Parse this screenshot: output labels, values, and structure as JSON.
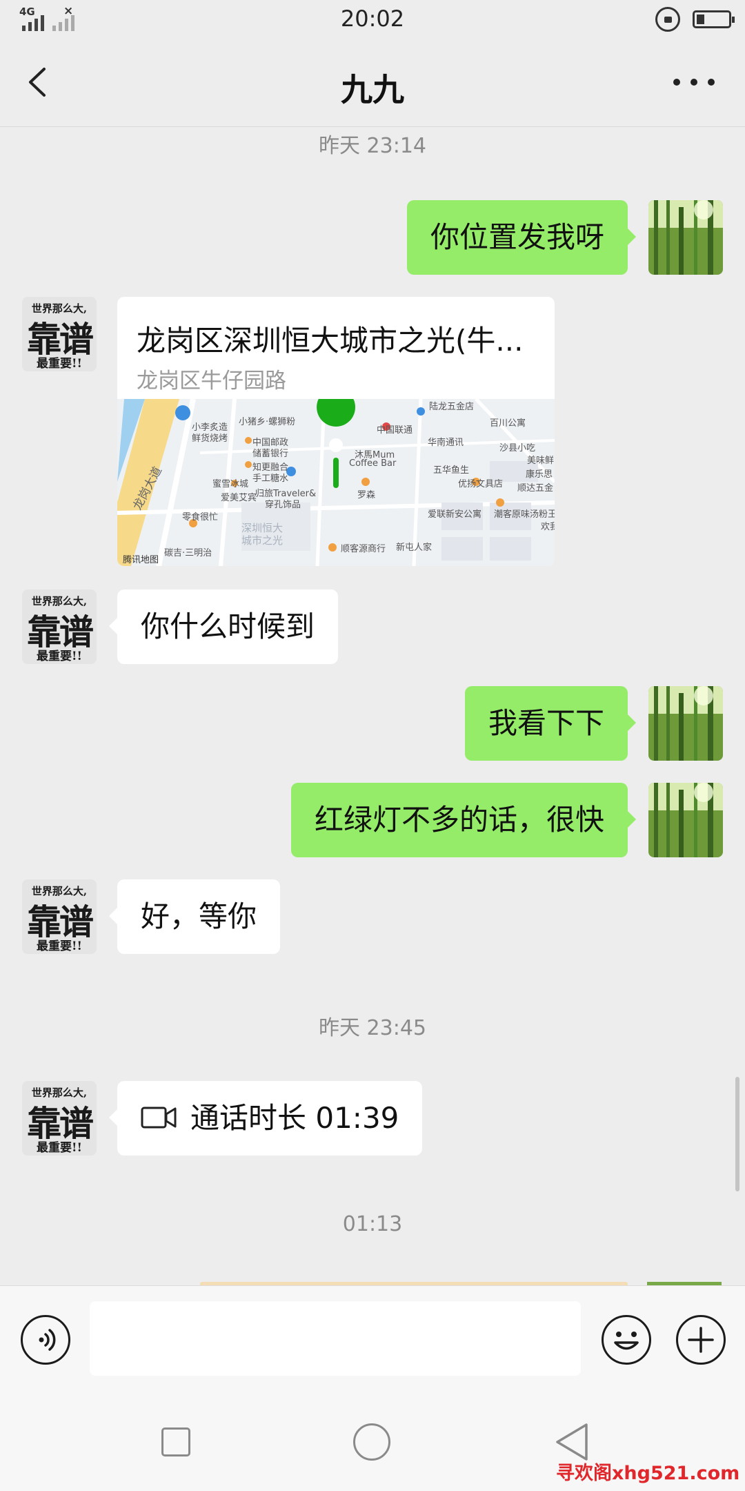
{
  "status_bar": {
    "network": "4G",
    "time": "20:02"
  },
  "header": {
    "title": "九九"
  },
  "messages": {
    "sep1": "昨天 23:14",
    "msg1": "你位置发我呀",
    "location_title": "龙岗区深圳恒大城市之光(牛...",
    "location_address": "龙岗区牛仔园路",
    "map_labels": {
      "l1": "小李炙造",
      "l2": "鲜货烧烤",
      "l3": "小猪乡·螺狮粉",
      "l4": "中国邮政",
      "l5": "储蓄银行",
      "l6": "知更融合",
      "l7": "手工糖水",
      "l8": "蜜雪冰城",
      "l9": "爱美艾宾",
      "l10": "零食很忙",
      "l11": "碳吉·三明治",
      "l12": "归旅Traveler&",
      "l13": "穿孔饰品",
      "l14": "深圳恒大",
      "l15": "城市之光",
      "l16": "中国联通",
      "l17": "沐馬Mum",
      "l18": "Coffee Bar",
      "l19": "罗森",
      "l20": "陆龙五金店",
      "l21": "百川公寓",
      "l22": "华南通讯",
      "l23": "沙县小吃",
      "l24": "五华鱼生",
      "l25": "优扬文具店",
      "l26": "美味鲜",
      "l27": "康乐思",
      "l28": "顺达五金",
      "l29": "爱联新安公寓",
      "l30": "潮客原味汤粉王",
      "l31": "新屯人家",
      "l32": "顺客源商行",
      "l33": "欢我",
      "l34": "龙岗大道",
      "map_brand": "腾讯地图"
    },
    "msg2": "你什么时候到",
    "msg3": "我看下下",
    "msg4": "红绿灯不多的话，很快",
    "msg5": "好，等你",
    "sep2": "昨天 23:45",
    "msg6": "通话时长 01:39",
    "sep3": "01:13",
    "avatar_text": {
      "line1": "世界那么大,",
      "line2": "靠谱",
      "line3": "最重要!!"
    }
  },
  "input": {
    "value": ""
  },
  "watermark": "寻欢阁xhg521.com",
  "colors": {
    "sent_bubble": "#95ec69",
    "received_bubble": "#ffffff",
    "background": "#ededed",
    "map_pin": "#1aad19",
    "watermark": "#e0272b"
  }
}
